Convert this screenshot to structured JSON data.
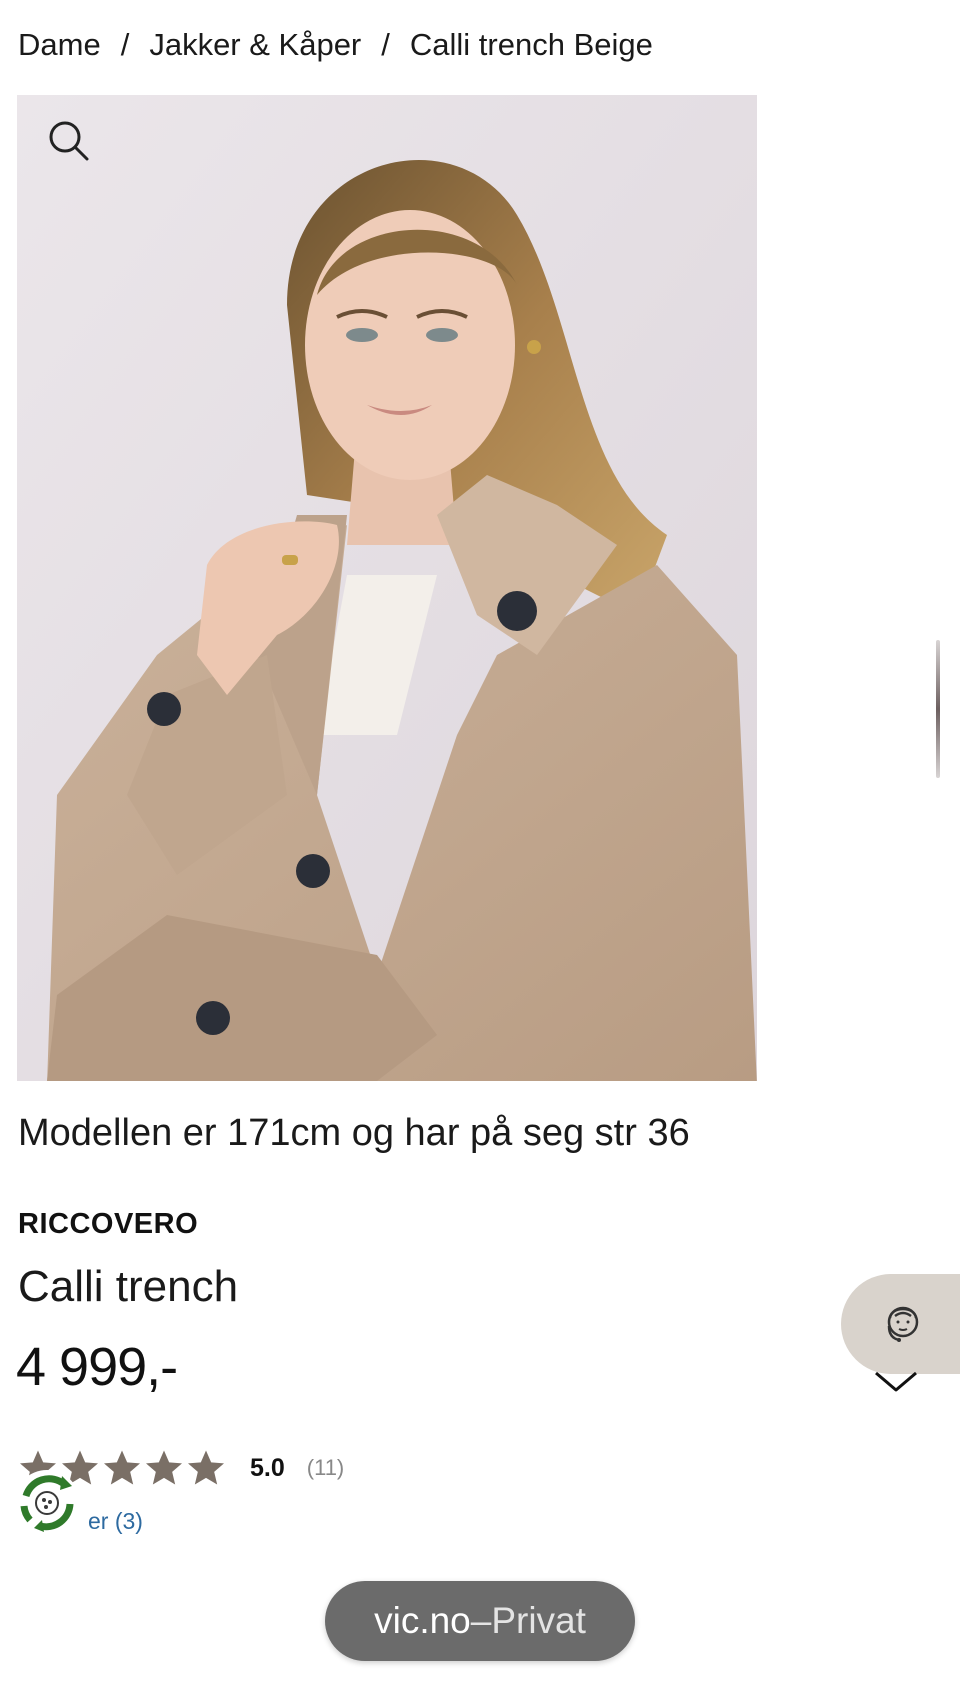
{
  "breadcrumb": {
    "items": [
      "Dame",
      "Jakker & Kåper",
      "Calli trench Beige"
    ],
    "separator": "/"
  },
  "gallery": {
    "zoom_icon": "search-icon"
  },
  "product": {
    "model_info": "Modellen er 171cm og har på seg str 36",
    "brand": "RICCOVERO",
    "name": "Calli trench",
    "price": "4 999,-"
  },
  "rating": {
    "stars_filled": 5,
    "value": "5.0",
    "count": "(11)",
    "reviews_link": "er (3)",
    "star_color": "#7a6f66"
  },
  "floating": {
    "chat_icon": "customer-service-icon",
    "chat_bg": "#d9d3cc",
    "eco_icon": "recycle-badge-icon",
    "eco_color": "#2f7a2a"
  },
  "browser": {
    "domain": "vic.no",
    "separator": " – ",
    "mode": "Privat"
  },
  "colors": {
    "coat": "#c7ae97",
    "background_photo": "#e6e1e6"
  }
}
